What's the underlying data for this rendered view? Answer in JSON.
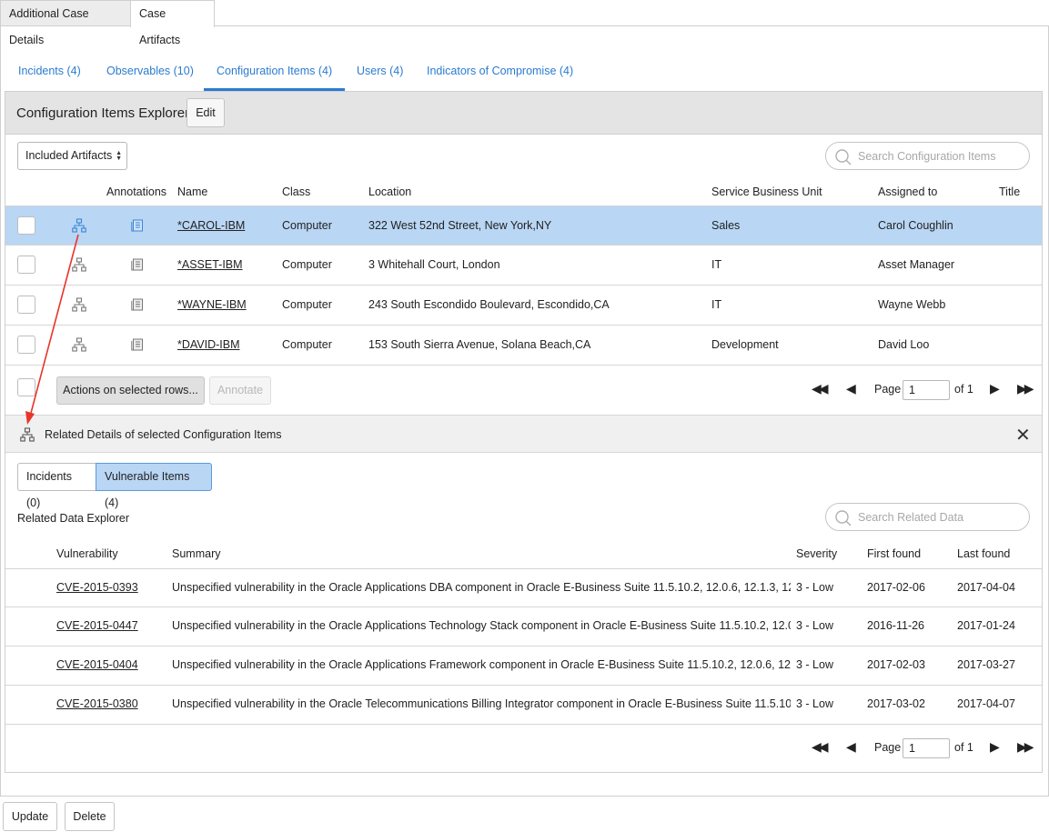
{
  "top_tabs": [
    {
      "label": "Additional Case Details"
    },
    {
      "label": "Case Artifacts"
    }
  ],
  "sub_tabs": [
    {
      "label": "Incidents (4)"
    },
    {
      "label": "Observables (10)"
    },
    {
      "label": "Configuration Items (4)"
    },
    {
      "label": "Users (4)"
    },
    {
      "label": "Indicators of Compromise (4)"
    }
  ],
  "explorer": {
    "title": "Configuration Items Explorer",
    "edit_label": "Edit",
    "filter_value": "Included Artifacts",
    "search_placeholder": "Search Configuration Items",
    "columns": [
      "Annotations",
      "Name",
      "Class",
      "Location",
      "Service Business Unit",
      "Assigned to",
      "Title"
    ],
    "rows": [
      {
        "name": "*CAROL-IBM",
        "class": "Computer",
        "location": "322 West 52nd Street, New York,NY",
        "sbu": "Sales",
        "assigned": "Carol Coughlin",
        "title": ""
      },
      {
        "name": "*ASSET-IBM",
        "class": "Computer",
        "location": "3 Whitehall Court, London",
        "sbu": "IT",
        "assigned": "Asset Manager",
        "title": ""
      },
      {
        "name": "*WAYNE-IBM",
        "class": "Computer",
        "location": "243 South Escondido Boulevard, Escondido,CA",
        "sbu": "IT",
        "assigned": "Wayne Webb",
        "title": ""
      },
      {
        "name": "*DAVID-IBM",
        "class": "Computer",
        "location": "153 South Sierra Avenue, Solana Beach,CA",
        "sbu": "Development",
        "assigned": "David Loo",
        "title": ""
      }
    ],
    "actions_label": "Actions on selected rows...",
    "annotate_label": "Annotate",
    "pager": {
      "page_label": "Page",
      "page_value": "1",
      "of_label": "of 1"
    }
  },
  "related": {
    "title": "Related Details of selected Configuration Items",
    "tabs": [
      {
        "label": "Incidents (0)"
      },
      {
        "label": "Vulnerable Items (4)"
      }
    ],
    "explorer_label": "Related Data Explorer",
    "search_placeholder": "Search Related Data",
    "columns": [
      "Vulnerability",
      "Summary",
      "Severity",
      "First found",
      "Last found"
    ],
    "rows": [
      {
        "vuln": "CVE-2015-0393",
        "summary": "Unspecified vulnerability in the Oracle Applications DBA component in Oracle E-Business Suite 11.5.10.2, 12.0.6, 12.1.3, 12....",
        "severity": "3 - Low",
        "first": "2017-02-06",
        "last": "2017-04-04"
      },
      {
        "vuln": "CVE-2015-0447",
        "summary": "Unspecified vulnerability in the Oracle Applications Technology Stack component in Oracle E-Business Suite 11.5.10.2, 12.0....",
        "severity": "3 - Low",
        "first": "2016-11-26",
        "last": "2017-01-24"
      },
      {
        "vuln": "CVE-2015-0404",
        "summary": "Unspecified vulnerability in the Oracle Applications Framework component in Oracle E-Business Suite 11.5.10.2, 12.0.6, 12....",
        "severity": "3 - Low",
        "first": "2017-02-03",
        "last": "2017-03-27"
      },
      {
        "vuln": "CVE-2015-0380",
        "summary": "Unspecified vulnerability in the Oracle Telecommunications Billing Integrator component in Oracle E-Business Suite 11.5.10...",
        "severity": "3 - Low",
        "first": "2017-03-02",
        "last": "2017-04-07"
      }
    ],
    "pager": {
      "page_label": "Page",
      "page_value": "1",
      "of_label": "of 1"
    }
  },
  "footer": {
    "update_label": "Update",
    "delete_label": "Delete"
  },
  "colors": {
    "link": "#2b7bd0",
    "selected_row": "#b9d6f4",
    "annotation_arrow": "#e8352a"
  },
  "icons": [
    "related-tree-icon",
    "annotation-note-icon",
    "search-icon",
    "close-icon",
    "first-page-icon",
    "prev-page-icon",
    "next-page-icon",
    "last-page-icon"
  ]
}
